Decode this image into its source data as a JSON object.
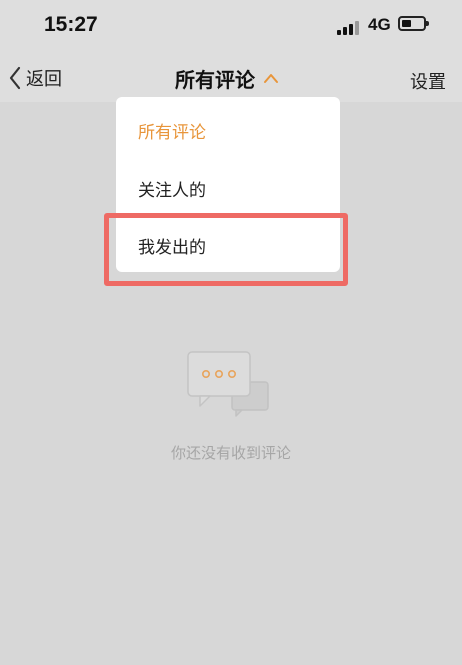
{
  "status": {
    "time": "15:27",
    "network": "4G"
  },
  "nav": {
    "back_label": "返回",
    "title": "所有评论",
    "settings_label": "设置"
  },
  "dropdown": {
    "items": [
      {
        "label": "所有评论",
        "selected": true
      },
      {
        "label": "关注人的",
        "selected": false
      },
      {
        "label": "我发出的",
        "selected": false
      }
    ]
  },
  "empty_state": {
    "text": "你还没有收到评论"
  },
  "colors": {
    "accent": "#e8953a",
    "highlight": "#ee6a64",
    "background": "#d7d7d7"
  }
}
